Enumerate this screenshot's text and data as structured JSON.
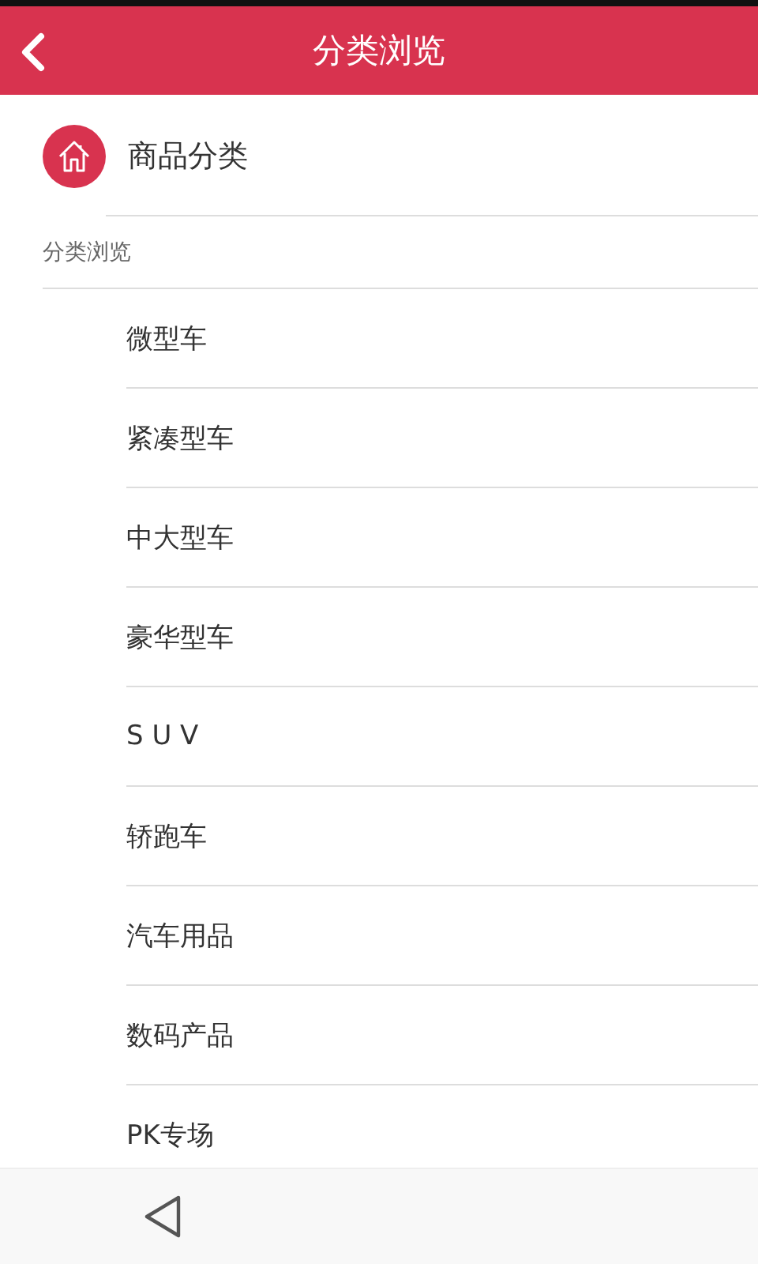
{
  "header": {
    "title": "分类浏览"
  },
  "category_header": {
    "label": "商品分类"
  },
  "section": {
    "label": "分类浏览"
  },
  "items": [
    {
      "label": "微型车"
    },
    {
      "label": "紧凑型车"
    },
    {
      "label": "中大型车"
    },
    {
      "label": "豪华型车"
    },
    {
      "label": "S U V"
    },
    {
      "label": "轿跑车"
    },
    {
      "label": "汽车用品"
    },
    {
      "label": "数码产品"
    },
    {
      "label": "PK专场"
    }
  ]
}
